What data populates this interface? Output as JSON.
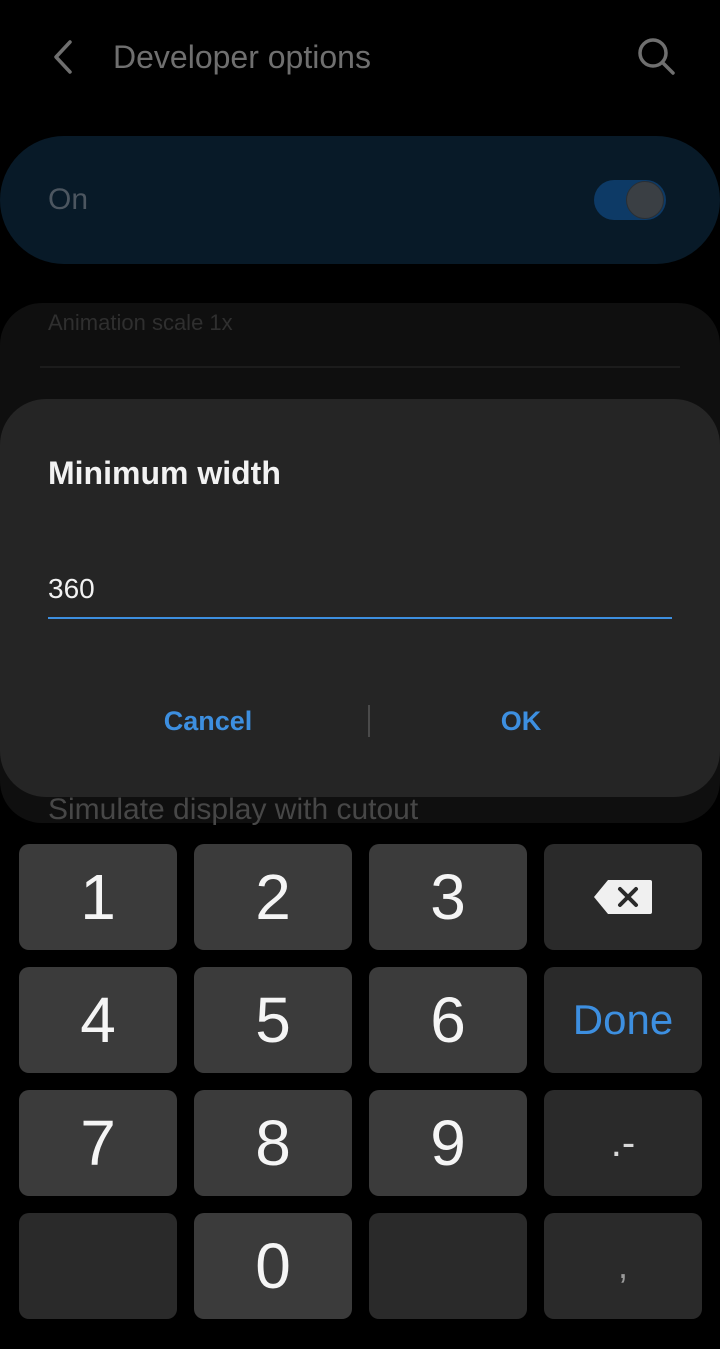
{
  "header": {
    "title": "Developer options"
  },
  "master_switch": {
    "label": "On",
    "state": "on"
  },
  "list": {
    "item_top": "Animation scale 1x",
    "item_bottom": "Simulate display with cutout"
  },
  "dialog": {
    "title": "Minimum width",
    "input_value": "360",
    "cancel_label": "Cancel",
    "ok_label": "OK"
  },
  "keyboard": {
    "keys": [
      "1",
      "2",
      "3",
      "4",
      "5",
      "6",
      "7",
      "8",
      "9",
      "0"
    ],
    "done_label": "Done",
    "punct_label": ".-",
    "comma_label": ","
  },
  "colors": {
    "accent": "#3d8fe0",
    "dialog_bg": "#252525",
    "key_bg": "#3b3b3b"
  }
}
